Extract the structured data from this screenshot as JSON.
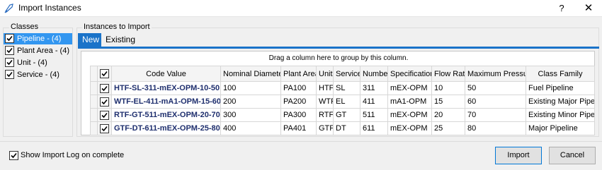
{
  "window": {
    "title": "Import Instances",
    "help_label": "?",
    "close_label": "✕"
  },
  "classes": {
    "legend": "Classes",
    "items": [
      {
        "label": "Pipeline - (4)",
        "checked": true,
        "selected": true
      },
      {
        "label": "Plant Area - (4)",
        "checked": true,
        "selected": false
      },
      {
        "label": "Unit - (4)",
        "checked": true,
        "selected": false
      },
      {
        "label": "Service - (4)",
        "checked": true,
        "selected": false
      }
    ]
  },
  "instances": {
    "legend": "Instances to Import",
    "tabs": [
      {
        "label": "New",
        "active": true
      },
      {
        "label": "Existing",
        "active": false
      }
    ],
    "group_hint": "Drag a column here to group by this column.",
    "columns": [
      "Code Value",
      "Nominal Diameter",
      "Plant Area",
      "Unit",
      "Service",
      "Number",
      "Specification",
      "Flow Rate",
      "Maximum Pressure",
      "Class Family"
    ],
    "rows": [
      {
        "checked": true,
        "cells": [
          "HTF-SL-311-mEX-OPM-10-50",
          "100",
          "PA100",
          "HTF",
          "SL",
          "311",
          "mEX-OPM",
          "10",
          "50",
          "Fuel Pipeline"
        ]
      },
      {
        "checked": true,
        "cells": [
          "WTF-EL-411-mA1-OPM-15-60",
          "200",
          "PA200",
          "WTF",
          "EL",
          "411",
          "mA1-OPM",
          "15",
          "60",
          "Existing Major Pipeline"
        ]
      },
      {
        "checked": true,
        "cells": [
          "RTF-GT-511-mEX-OPM-20-70",
          "300",
          "PA300",
          "RTF",
          "GT",
          "511",
          "mEX-OPM",
          "20",
          "70",
          "Existing Minor Pipeline"
        ]
      },
      {
        "checked": true,
        "cells": [
          "GTF-DT-611-mEX-OPM-25-80",
          "400",
          "PA401",
          "GTF",
          "DT",
          "611",
          "mEX-OPM",
          "25",
          "80",
          "Major Pipeline"
        ]
      }
    ]
  },
  "footer": {
    "log_label": "Show Import Log on complete",
    "log_checked": true,
    "import_label": "Import",
    "cancel_label": "Cancel"
  },
  "colors": {
    "accent": "#1a73c9",
    "selection": "#3296f0",
    "code_text": "#1f2f6e"
  }
}
